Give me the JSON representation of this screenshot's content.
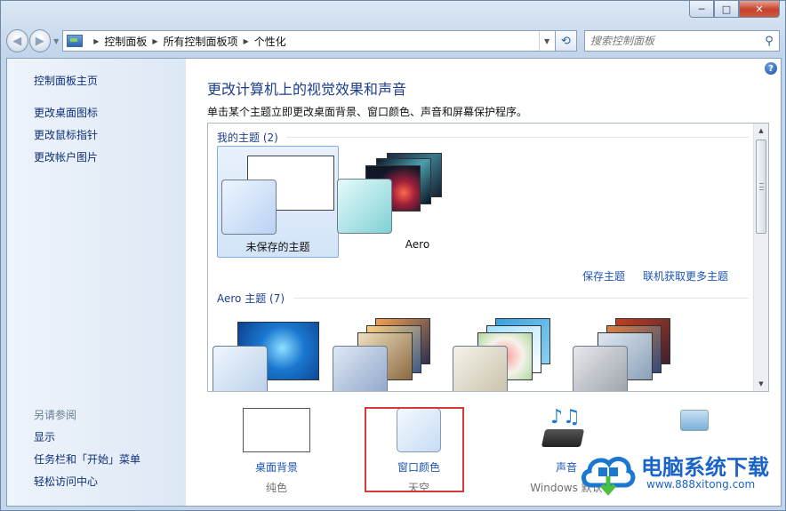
{
  "window": {
    "minimize": "─",
    "maximize": "□",
    "close": "✕",
    "accent": "#1d3e8c",
    "link_color": "#1d55b5",
    "highlight_color": "#d43a3a"
  },
  "address": {
    "crumbs": [
      "控制面板",
      "所有控制面板项",
      "个性化"
    ]
  },
  "search": {
    "placeholder": "搜索控制面板"
  },
  "sidebar": {
    "home": "控制面板主页",
    "links": [
      "更改桌面图标",
      "更改鼠标指针",
      "更改帐户图片"
    ],
    "see_also": "另请参阅",
    "see_also_links": [
      "显示",
      "任务栏和「开始」菜单",
      "轻松访问中心"
    ]
  },
  "main": {
    "title": "更改计算机上的视觉效果和声音",
    "subtitle": "单击某个主题立即更改桌面背景、窗口颜色、声音和屏幕保护程序。",
    "my_themes": {
      "header": "我的主题 (2)",
      "items": [
        {
          "label": "未保存的主题",
          "selected": true
        },
        {
          "label": "Aero",
          "selected": false
        }
      ],
      "save_link": "保存主题",
      "online_link": "联机获取更多主题"
    },
    "aero_themes": {
      "header": "Aero 主题 (7)"
    }
  },
  "bottom": [
    {
      "link": "桌面背景",
      "value": "纯色"
    },
    {
      "link": "窗口颜色",
      "value": "天空"
    },
    {
      "link": "声音",
      "value": "Windows 默认"
    }
  ],
  "watermark": {
    "title": "电脑系统下载",
    "url": "www.888xitong.com"
  }
}
